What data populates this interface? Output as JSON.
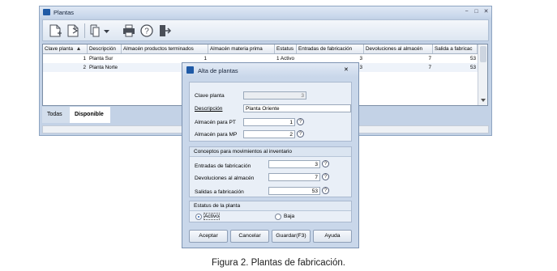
{
  "main_window": {
    "title": "Plantas",
    "controls": {
      "minimize": "−",
      "restore": "□",
      "close": "✕"
    }
  },
  "toolbar": {
    "icons": [
      "new-icon",
      "edit-icon",
      "copy-icon",
      "dropdown-icon",
      "print-icon",
      "help-icon",
      "exit-icon"
    ]
  },
  "grid": {
    "columns": [
      "Clave planta",
      "Descripción",
      "Almacén productos terminados",
      "Almacén materia prima",
      "Estatus",
      "Entradas de fabricación",
      "Devoluciones al almacén",
      "Salida a fabricac"
    ],
    "rows": [
      [
        "1",
        "Planta Sur",
        "1",
        "",
        "1 Activo",
        "3",
        "7",
        "53"
      ],
      [
        "2",
        "Planta Norte",
        "",
        "",
        "",
        "3",
        "7",
        "53"
      ]
    ]
  },
  "tabs": [
    "Todas",
    "Disponible"
  ],
  "dialog": {
    "title": "Alta de plantas",
    "close": "✕",
    "fields": {
      "clave_label": "Clave planta",
      "clave_value": "3",
      "descripcion_label": "Descripción",
      "descripcion_value": "Planta Oriente",
      "almacen_pt_label": "Almacén para PT",
      "almacen_pt_value": "1",
      "almacen_mp_label": "Almacén para MP",
      "almacen_mp_value": "2"
    },
    "conceptos": {
      "title": "Conceptos para movimientos al inventario",
      "entradas_label": "Entradas de fabricación",
      "entradas_value": "3",
      "devoluciones_label": "Devoluciones al almacén",
      "devoluciones_value": "7",
      "salidas_label": "Salidas a fabricación",
      "salidas_value": "53"
    },
    "estatus": {
      "title": "Estatus de la planta",
      "activo": "Activo",
      "baja": "Baja",
      "selected": "Activo"
    },
    "buttons": {
      "aceptar": "Aceptar",
      "cancelar": "Cancelar",
      "guardar": "Guardar(F3)",
      "ayuda": "Ayuda"
    },
    "help_glyph": "?"
  },
  "caption": "Figura 2. Plantas de fabricación."
}
